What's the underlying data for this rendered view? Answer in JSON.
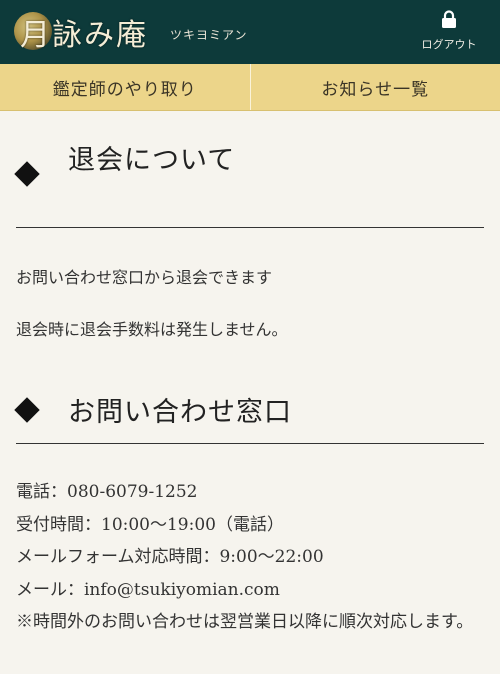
{
  "header": {
    "logo_text": "月詠み庵",
    "logo_sub": "ツキヨミアン",
    "logout_label": "ログアウト"
  },
  "nav": {
    "tabs": [
      {
        "label": "鑑定師のやり取り"
      },
      {
        "label": "お知らせ一覧"
      }
    ]
  },
  "withdrawal": {
    "title": "退会について",
    "paragraphs": [
      "お問い合わせ窓口から退会できます",
      "退会時に退会手数料は発生しません。"
    ]
  },
  "contact": {
    "title": "お問い合わせ窓口",
    "lines": [
      "電話：080-6079-1252",
      "受付時間：10:00〜19:00（電話）",
      "メールフォーム対応時間：9:00〜22:00",
      "メール：info@tsukiyomian.com"
    ],
    "note": "※時間外のお問い合わせは翌営業日以降に順次対応します。"
  },
  "colors": {
    "header_bg": "#0d3a3a",
    "nav_bg": "#ecd58a",
    "page_bg": "#f6f4ee"
  }
}
